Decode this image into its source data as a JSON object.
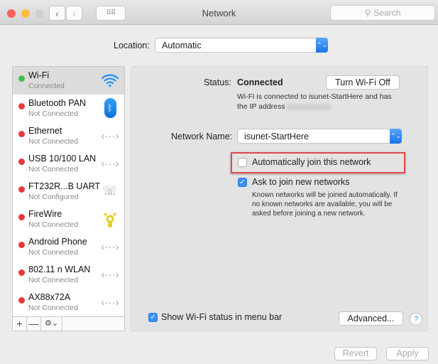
{
  "window": {
    "title": "Network",
    "search_placeholder": "Search",
    "colors": {
      "close": "#fc605c",
      "minimize": "#fdbc40",
      "zoom": "#cfcfcf"
    }
  },
  "location": {
    "label": "Location:",
    "value": "Automatic"
  },
  "services": [
    {
      "name": "Wi-Fi",
      "status": "Connected",
      "state_color": "#3ec14a",
      "icon": "wifi-icon",
      "selected": true
    },
    {
      "name": "Bluetooth PAN",
      "status": "Not Connected",
      "state_color": "#e9383c",
      "icon": "bluetooth-icon"
    },
    {
      "name": "Ethernet",
      "status": "Not Connected",
      "state_color": "#e9383c",
      "icon": "ethernet-icon"
    },
    {
      "name": "USB 10/100 LAN",
      "status": "Not Connected",
      "state_color": "#e9383c",
      "icon": "ethernet-icon"
    },
    {
      "name": "FT232R...B UART",
      "status": "Not Configured",
      "state_color": "#e9383c",
      "icon": "modem-phone-icon"
    },
    {
      "name": "FireWire",
      "status": "Not Connected",
      "state_color": "#e9383c",
      "icon": "firewire-icon"
    },
    {
      "name": "Android Phone",
      "status": "Not Connected",
      "state_color": "#e9383c",
      "icon": "ethernet-icon"
    },
    {
      "name": "802.11 n WLAN",
      "status": "Not Connected",
      "state_color": "#e9383c",
      "icon": "ethernet-icon"
    },
    {
      "name": "AX88x72A",
      "status": "Not Connected",
      "state_color": "#e9383c",
      "icon": "ethernet-icon"
    }
  ],
  "sidebar_footer": {
    "add": "+",
    "remove": "—",
    "action": "⚙︎⌄"
  },
  "detail": {
    "status_label": "Status:",
    "status_value": "Connected",
    "turn_off": "Turn Wi-Fi Off",
    "status_desc_1": "Wi-Fi is connected to isunet-StartHere and has",
    "status_desc_2": "the IP address",
    "network_name_label": "Network Name:",
    "network_name": "isunet-StartHere",
    "auto_join": {
      "label": "Automatically join this network",
      "checked": false
    },
    "ask_join": {
      "label": "Ask to join new networks",
      "checked": true
    },
    "ask_desc": [
      "Known networks will be joined automatically. If",
      "no known networks are available, you will be",
      "asked before joining a new network."
    ],
    "show_status": {
      "label": "Show Wi-Fi status in menu bar",
      "checked": true
    },
    "advanced": "Advanced...",
    "help": "?"
  },
  "footer": {
    "revert": "Revert",
    "apply": "Apply"
  },
  "highlight_color": "#e0474c"
}
